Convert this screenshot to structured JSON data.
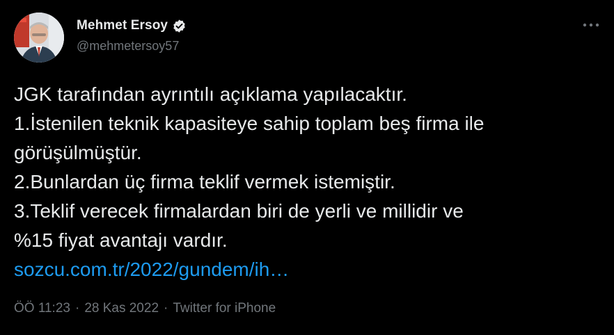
{
  "author": {
    "display_name": "Mehmet Ersoy",
    "handle": "@mehmetersoy57",
    "verified": true,
    "avatar_icon": "profile-photo"
  },
  "tweet": {
    "lines": [
      "JGK tarafından ayrıntılı açıklama yapılacaktır.",
      "1.İstenilen teknik kapasiteye sahip toplam beş firma ile",
      "görüşülmüştür.",
      "2.Bunlardan üç firma teklif vermek istemiştir.",
      "3.Teklif verecek firmalardan biri de yerli ve millidir ve",
      "%15 fiyat avantajı vardır."
    ],
    "link_text": "sozcu.com.tr/2022/gundem/ih…"
  },
  "meta": {
    "time": "ÖÖ 11:23",
    "separator": "·",
    "date": "28 Kas 2022",
    "source": "Twitter for iPhone"
  },
  "colors": {
    "background": "#000000",
    "text": "#e7e9ea",
    "secondary": "#71767b",
    "link": "#1d9bf0"
  },
  "icons": {
    "verified": "verified-badge-icon",
    "more": "more-options-icon"
  }
}
